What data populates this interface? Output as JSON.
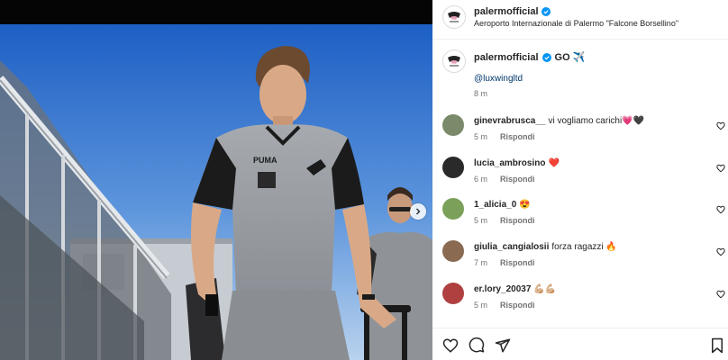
{
  "post": {
    "username": "palermofficial",
    "location": "Aeroporto Internazionale di Palermo \"Falcone Borsellino\"",
    "caption": "GO ✈️",
    "mention": "@luxwingltd",
    "time": "8 m"
  },
  "comments": [
    {
      "user": "ginevrabrusca__",
      "text": "vi vogliamo carichi💗🖤",
      "time": "5 m",
      "reply": "Rispondi",
      "avatar_color": "#7a8a6a"
    },
    {
      "user": "lucia_ambrosino",
      "text": "❤️",
      "time": "6 m",
      "reply": "Rispondi",
      "avatar_color": "#2a2a2a"
    },
    {
      "user": "1_alicia_0",
      "text": "😍",
      "time": "5 m",
      "reply": "Rispondi",
      "avatar_color": "#7aa05a"
    },
    {
      "user": "giulia_cangialosii",
      "text": "forza ragazzi 🔥",
      "time": "7 m",
      "reply": "Rispondi",
      "avatar_color": "#8a6a50"
    },
    {
      "user": "er.lory_20037",
      "text": "💪🏼💪🏼",
      "time": "5 m",
      "reply": "Rispondi",
      "avatar_color": "#b04040"
    }
  ],
  "icons": {
    "verified": "verified-badge-icon",
    "like": "heart-icon",
    "comment": "comment-icon",
    "share": "share-icon",
    "save": "bookmark-icon",
    "next": "chevron-right-icon"
  },
  "colors": {
    "verified": "#0095f6",
    "link": "#00376b",
    "muted": "#737373"
  }
}
